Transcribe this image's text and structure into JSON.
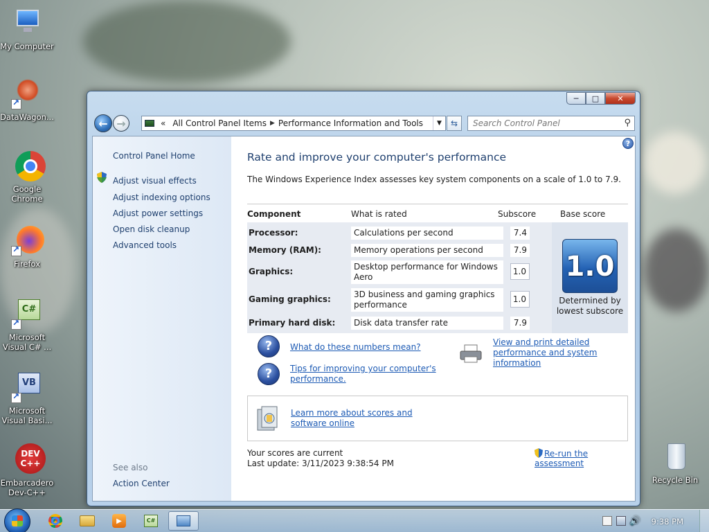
{
  "desktop": {
    "icons": [
      {
        "label": "My Computer"
      },
      {
        "label": "DataWagon..."
      },
      {
        "label": "Google Chrome"
      },
      {
        "label": "Firefox"
      },
      {
        "label": "Microsoft Visual C# ..."
      },
      {
        "label": "Microsoft Visual Basi..."
      },
      {
        "label": "Embarcadero Dev-C++"
      },
      {
        "label": "Recycle Bin"
      }
    ]
  },
  "window": {
    "address": {
      "root_label": "«",
      "segments": [
        "All Control Panel Items",
        "Performance Information and Tools"
      ]
    },
    "search_placeholder": "Search Control Panel",
    "sidebar": {
      "home": "Control Panel Home",
      "items": [
        "Adjust visual effects",
        "Adjust indexing options",
        "Adjust power settings",
        "Open disk cleanup",
        "Advanced tools"
      ],
      "see_also": "See also",
      "see_also_items": [
        "Action Center"
      ]
    },
    "main": {
      "title": "Rate and improve your computer's performance",
      "intro": "The Windows Experience Index assesses key system components on a scale of 1.0 to 7.9.",
      "table": {
        "headers": {
          "component": "Component",
          "what": "What is rated",
          "subscore": "Subscore",
          "base": "Base score"
        },
        "rows": [
          {
            "component": "Processor:",
            "what": "Calculations per second",
            "subscore": "7.4"
          },
          {
            "component": "Memory (RAM):",
            "what": "Memory operations per second",
            "subscore": "7.9"
          },
          {
            "component": "Graphics:",
            "what": "Desktop performance for Windows Aero",
            "subscore": "1.0"
          },
          {
            "component": "Gaming graphics:",
            "what": "3D business and gaming graphics performance",
            "subscore": "1.0"
          },
          {
            "component": "Primary hard disk:",
            "what": "Disk data transfer rate",
            "subscore": "7.9"
          }
        ],
        "base_score": "1.0",
        "base_caption": "Determined by lowest subscore"
      },
      "links": {
        "numbers": "What do these numbers mean?",
        "tips": "Tips for improving your computer's performance.",
        "print": "View and print detailed performance and system information",
        "learn": "Learn more about scores and software online"
      },
      "status": {
        "current": "Your scores are current",
        "last_update": "Last update: 3/11/2023 9:38:54 PM",
        "rerun": "Re-run the assessment"
      }
    }
  },
  "taskbar": {
    "clock": "9:38 PM"
  }
}
